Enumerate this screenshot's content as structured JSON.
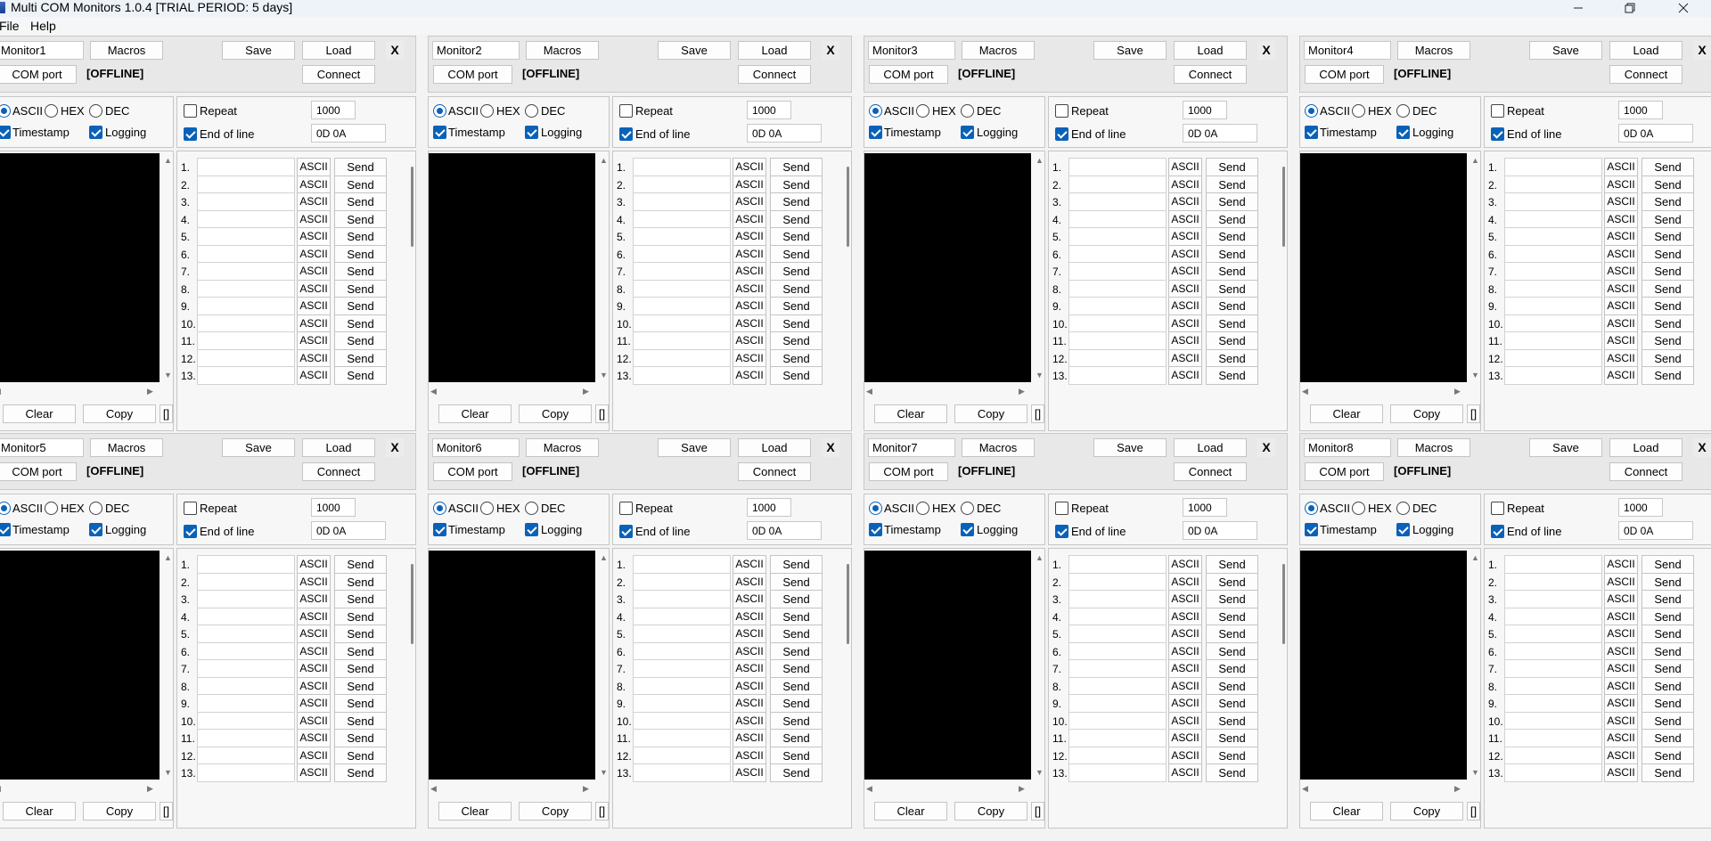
{
  "window": {
    "title": "Multi COM Monitors 1.0.4 [TRIAL PERIOD: 5 days]",
    "controls": {
      "minimize": "─",
      "maximize": "❐",
      "close": "✕"
    }
  },
  "menu": [
    "File",
    "Help"
  ],
  "labels": {
    "macros": "Macros",
    "save": "Save",
    "load": "Load",
    "close_x": "X",
    "com_port": "COM port",
    "offline": "[OFFLINE]",
    "connect": "Connect",
    "ascii": "ASCII",
    "hex": "HEX",
    "dec": "DEC",
    "timestamp": "Timestamp",
    "logging": "Logging",
    "repeat": "Repeat",
    "repeat_value": "1000",
    "end_of_line": "End of line",
    "eol_value": "0D 0A",
    "clear": "Clear",
    "copy": "Copy",
    "brackets": "[]",
    "macro_format": "ASCII",
    "send": "Send"
  },
  "macro_numbers": [
    "1.",
    "2.",
    "3.",
    "4.",
    "5.",
    "6.",
    "7.",
    "8.",
    "9.",
    "10.",
    "11.",
    "12.",
    "13."
  ],
  "monitors": [
    {
      "name": "Monitor1"
    },
    {
      "name": "Monitor2"
    },
    {
      "name": "Monitor3"
    },
    {
      "name": "Monitor4"
    },
    {
      "name": "Monitor5"
    },
    {
      "name": "Monitor6"
    },
    {
      "name": "Monitor7"
    },
    {
      "name": "Monitor8"
    }
  ],
  "state": {
    "format_selected": "ASCII",
    "timestamp_checked": true,
    "logging_checked": true,
    "repeat_checked": false,
    "end_of_line_checked": true
  },
  "colors": {
    "accent": "#0a62b8",
    "log_background": "#000000"
  }
}
